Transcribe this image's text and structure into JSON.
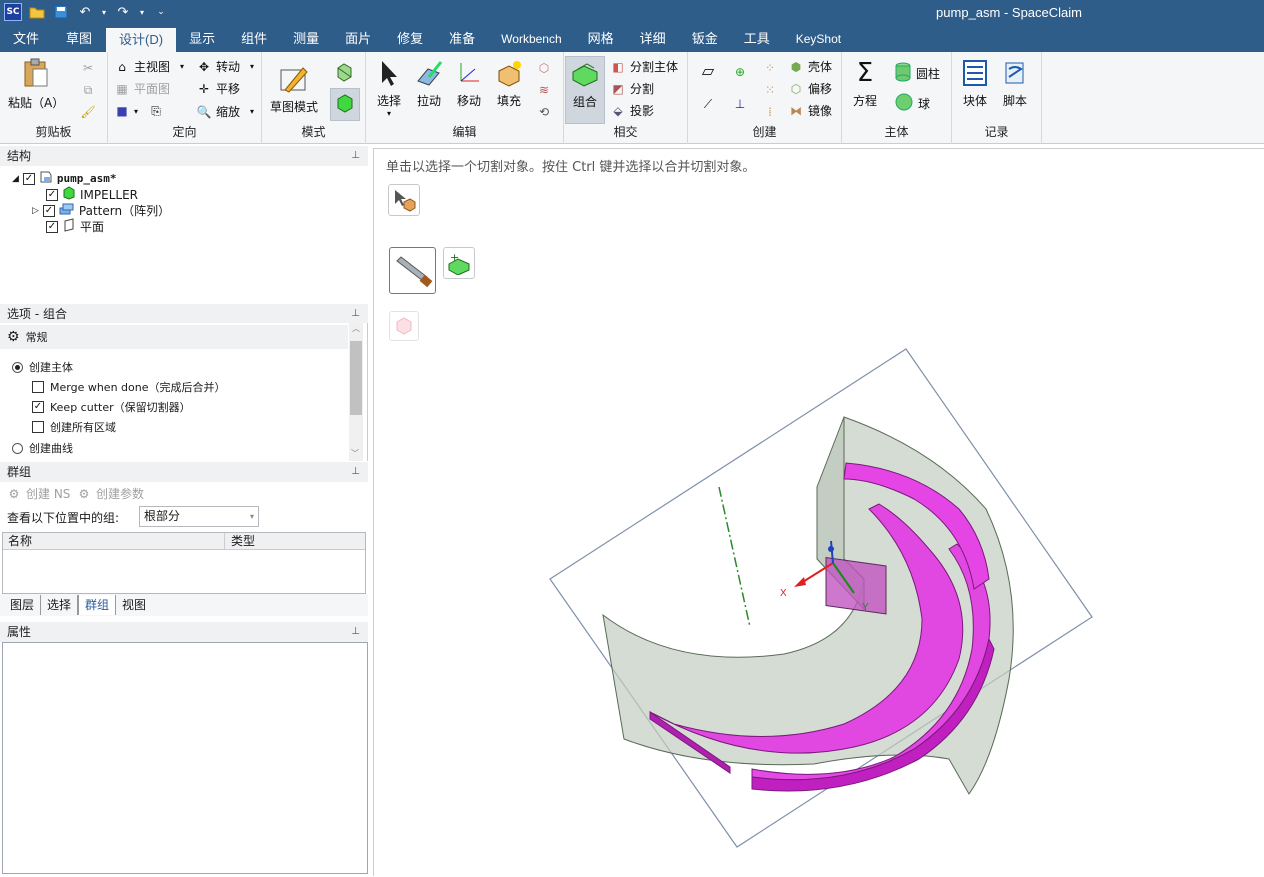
{
  "app": {
    "window_title": "pump_asm - SpaceClaim",
    "logo": "SC"
  },
  "menu": {
    "items": [
      "文件",
      "草图",
      "设计(D)",
      "显示",
      "组件",
      "测量",
      "面片",
      "修复",
      "准备",
      "Workbench",
      "网格",
      "详细",
      "钣金",
      "工具",
      "KeyShot"
    ],
    "active": "设计(D)"
  },
  "ribbon": {
    "clipboard": {
      "paste": "粘贴（A）",
      "label": "剪贴板"
    },
    "orient": {
      "home": "主视图",
      "plan": "平面图",
      "rotate": "转动",
      "pan": "平移",
      "zoom": "缩放",
      "label": "定向"
    },
    "mode": {
      "sketch": "草图模式",
      "label": "模式"
    },
    "edit": {
      "select": "选择",
      "pull": "拉动",
      "move": "移动",
      "fill": "填充",
      "label": "编辑"
    },
    "intersect": {
      "combine": "组合",
      "split_body": "分割主体",
      "split": "分割",
      "project": "投影",
      "label": "相交"
    },
    "create": {
      "shell": "壳体",
      "offset": "偏移",
      "mirror": "镜像",
      "label": "创建"
    },
    "body": {
      "equation": "方程",
      "cylinder": "圆柱",
      "sphere": "球",
      "label": "主体"
    },
    "record": {
      "block": "块体",
      "script": "脚本",
      "label": "记录"
    }
  },
  "structure": {
    "header": "结构",
    "root": "pump_asm*",
    "items": [
      "IMPELLER",
      "Pattern（阵列）",
      "平面"
    ]
  },
  "options": {
    "header": "选项 - 组合",
    "section": "常规",
    "create_body": "创建主体",
    "merge_when_done": "Merge when done（完成后合并）",
    "keep_cutter": "Keep cutter（保留切割器）",
    "create_all_regions": "创建所有区域",
    "create_curves": "创建曲线"
  },
  "groups": {
    "header": "群组",
    "create_ns": "创建 NS",
    "create_param": "创建参数",
    "view_in_label": "查看以下位置中的组:",
    "view_in_value": "根部分",
    "col_name": "名称",
    "col_type": "类型"
  },
  "tabs": [
    "图层",
    "选择",
    "群组",
    "视图"
  ],
  "tabs_active": "群组",
  "properties": {
    "header": "属性"
  },
  "viewport": {
    "hint": "单击以选择一个切割对象。按住 Ctrl 键并选择以合并切割对象。",
    "axis_x": "X",
    "axis_y": "Y",
    "colors": {
      "body": "#e040e0",
      "shroud": "#c8d0c8",
      "plane_edge": "#7a8aa8"
    }
  }
}
